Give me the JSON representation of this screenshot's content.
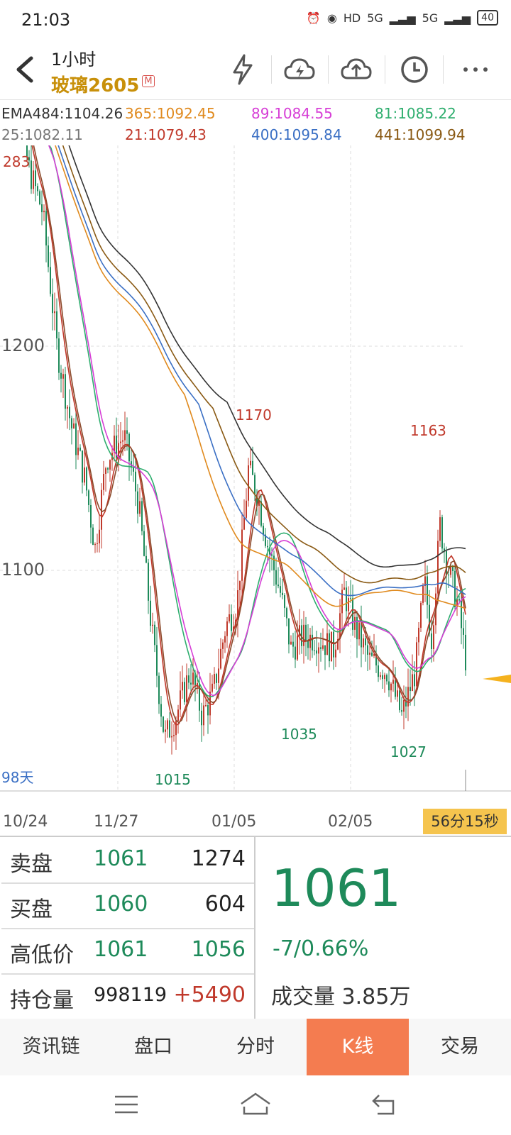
{
  "status_bar": {
    "time": "21:03",
    "network_1": "5G",
    "network_2": "5G",
    "battery": "40",
    "hd": "HD"
  },
  "header": {
    "title": "1小时",
    "symbol": "玻璃2605",
    "badge": "M"
  },
  "ma_legend": [
    {
      "text": "EMA484:1104.26",
      "color": "#333333"
    },
    {
      "text": "365:1092.45",
      "color": "#e08a1e"
    },
    {
      "text": "89:1084.55",
      "color": "#d63ed6"
    },
    {
      "text": "81:1085.22",
      "color": "#2eae6e"
    },
    {
      "text": "25:1082.11",
      "color": "#777777"
    },
    {
      "text": "21:1079.43",
      "color": "#c0392b"
    },
    {
      "text": "400:1095.84",
      "color": "#3a6fc4"
    },
    {
      "text": "441:1099.94",
      "color": "#8a5a14"
    }
  ],
  "chart_data": {
    "type": "candlestick",
    "y_ticks": [
      "1200",
      "1100"
    ],
    "y_top_label": "283",
    "x_ticks": [
      "10/24",
      "11/27",
      "01/05",
      "02/05"
    ],
    "annotations": [
      {
        "text": "1170",
        "at": "high"
      },
      {
        "text": "1163",
        "at": "high"
      },
      {
        "text": "1015",
        "at": "low"
      },
      {
        "text": "1035",
        "at": "low"
      },
      {
        "text": "1027",
        "at": "low"
      }
    ],
    "range_label": "98天",
    "last_price": 1061
  },
  "timer": "56分15秒",
  "quote": {
    "rows": [
      {
        "label": "卖盘",
        "v1": "1061",
        "v2": "1274"
      },
      {
        "label": "买盘",
        "v1": "1060",
        "v2": "604"
      },
      {
        "label": "高低价",
        "v1": "1061",
        "v2": "1056"
      },
      {
        "label": "持仓量",
        "v1": "998119",
        "v2": "+5490"
      }
    ],
    "price": "1061",
    "change": "-7/0.66%",
    "volume_label": "成交量",
    "volume": "3.85万"
  },
  "tabs": [
    "资讯链",
    "盘口",
    "分时",
    "K线",
    "交易"
  ],
  "colors": {
    "up": "#c0392b",
    "down": "#1e8a5a",
    "accent": "#f47c50"
  }
}
